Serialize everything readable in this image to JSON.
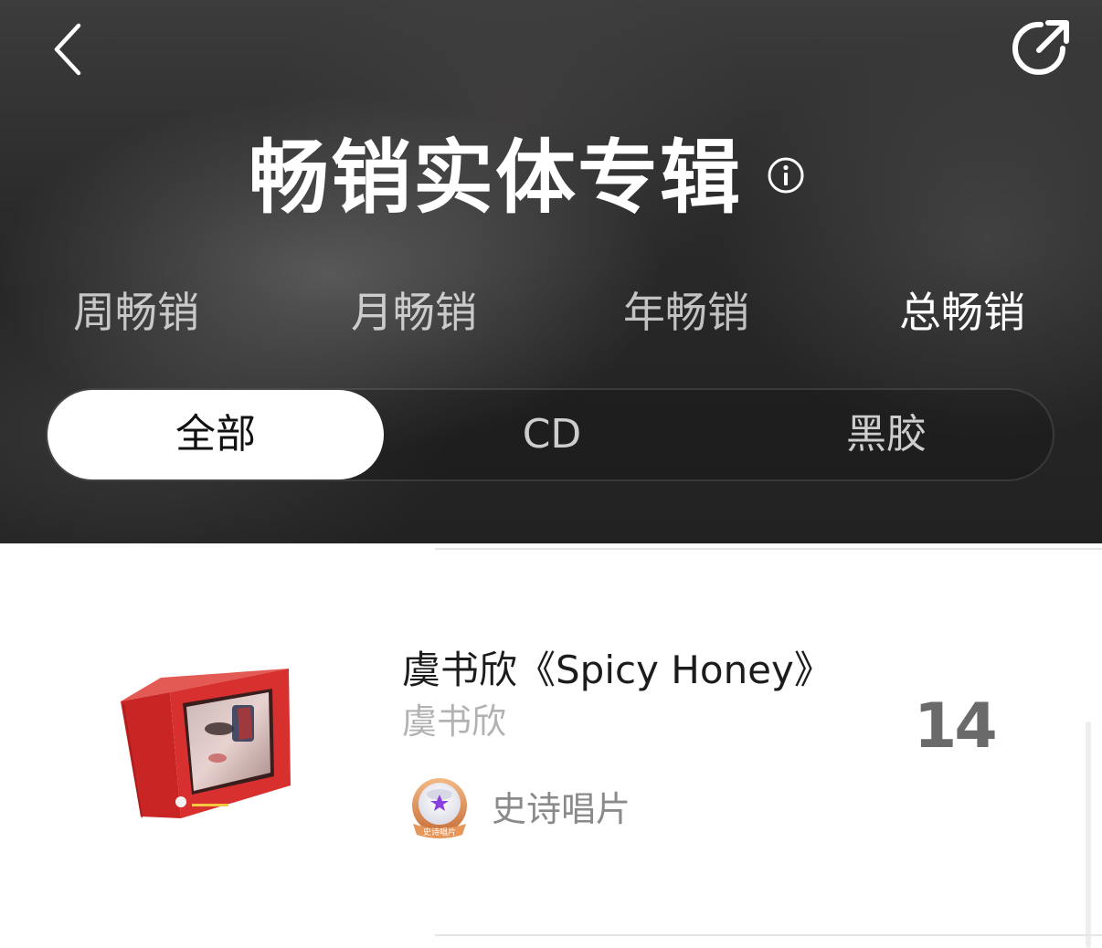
{
  "header": {
    "title": "畅销实体专辑",
    "period_tabs": [
      {
        "label": "周畅销",
        "active": false
      },
      {
        "label": "月畅销",
        "active": false
      },
      {
        "label": "年畅销",
        "active": false
      },
      {
        "label": "总畅销",
        "active": true
      }
    ],
    "format_tabs": [
      {
        "label": "全部",
        "active": true
      },
      {
        "label": "CD",
        "active": false
      },
      {
        "label": "黑胶",
        "active": false
      }
    ],
    "icons": {
      "back": "chevron-left-icon",
      "share": "share-icon",
      "info": "info-icon"
    }
  },
  "list": {
    "items": [
      {
        "title": "虞书欣《Spicy Honey》",
        "artist": "虞书欣",
        "rank": "14",
        "badge_label": "史诗唱片",
        "badge_icon_text": "史诗唱片"
      }
    ]
  },
  "colors": {
    "header_bg": "#2a2a2a",
    "album_red": "#d42a2a",
    "badge_purple": "#7a3ad6",
    "badge_orange": "#e08a4a"
  }
}
